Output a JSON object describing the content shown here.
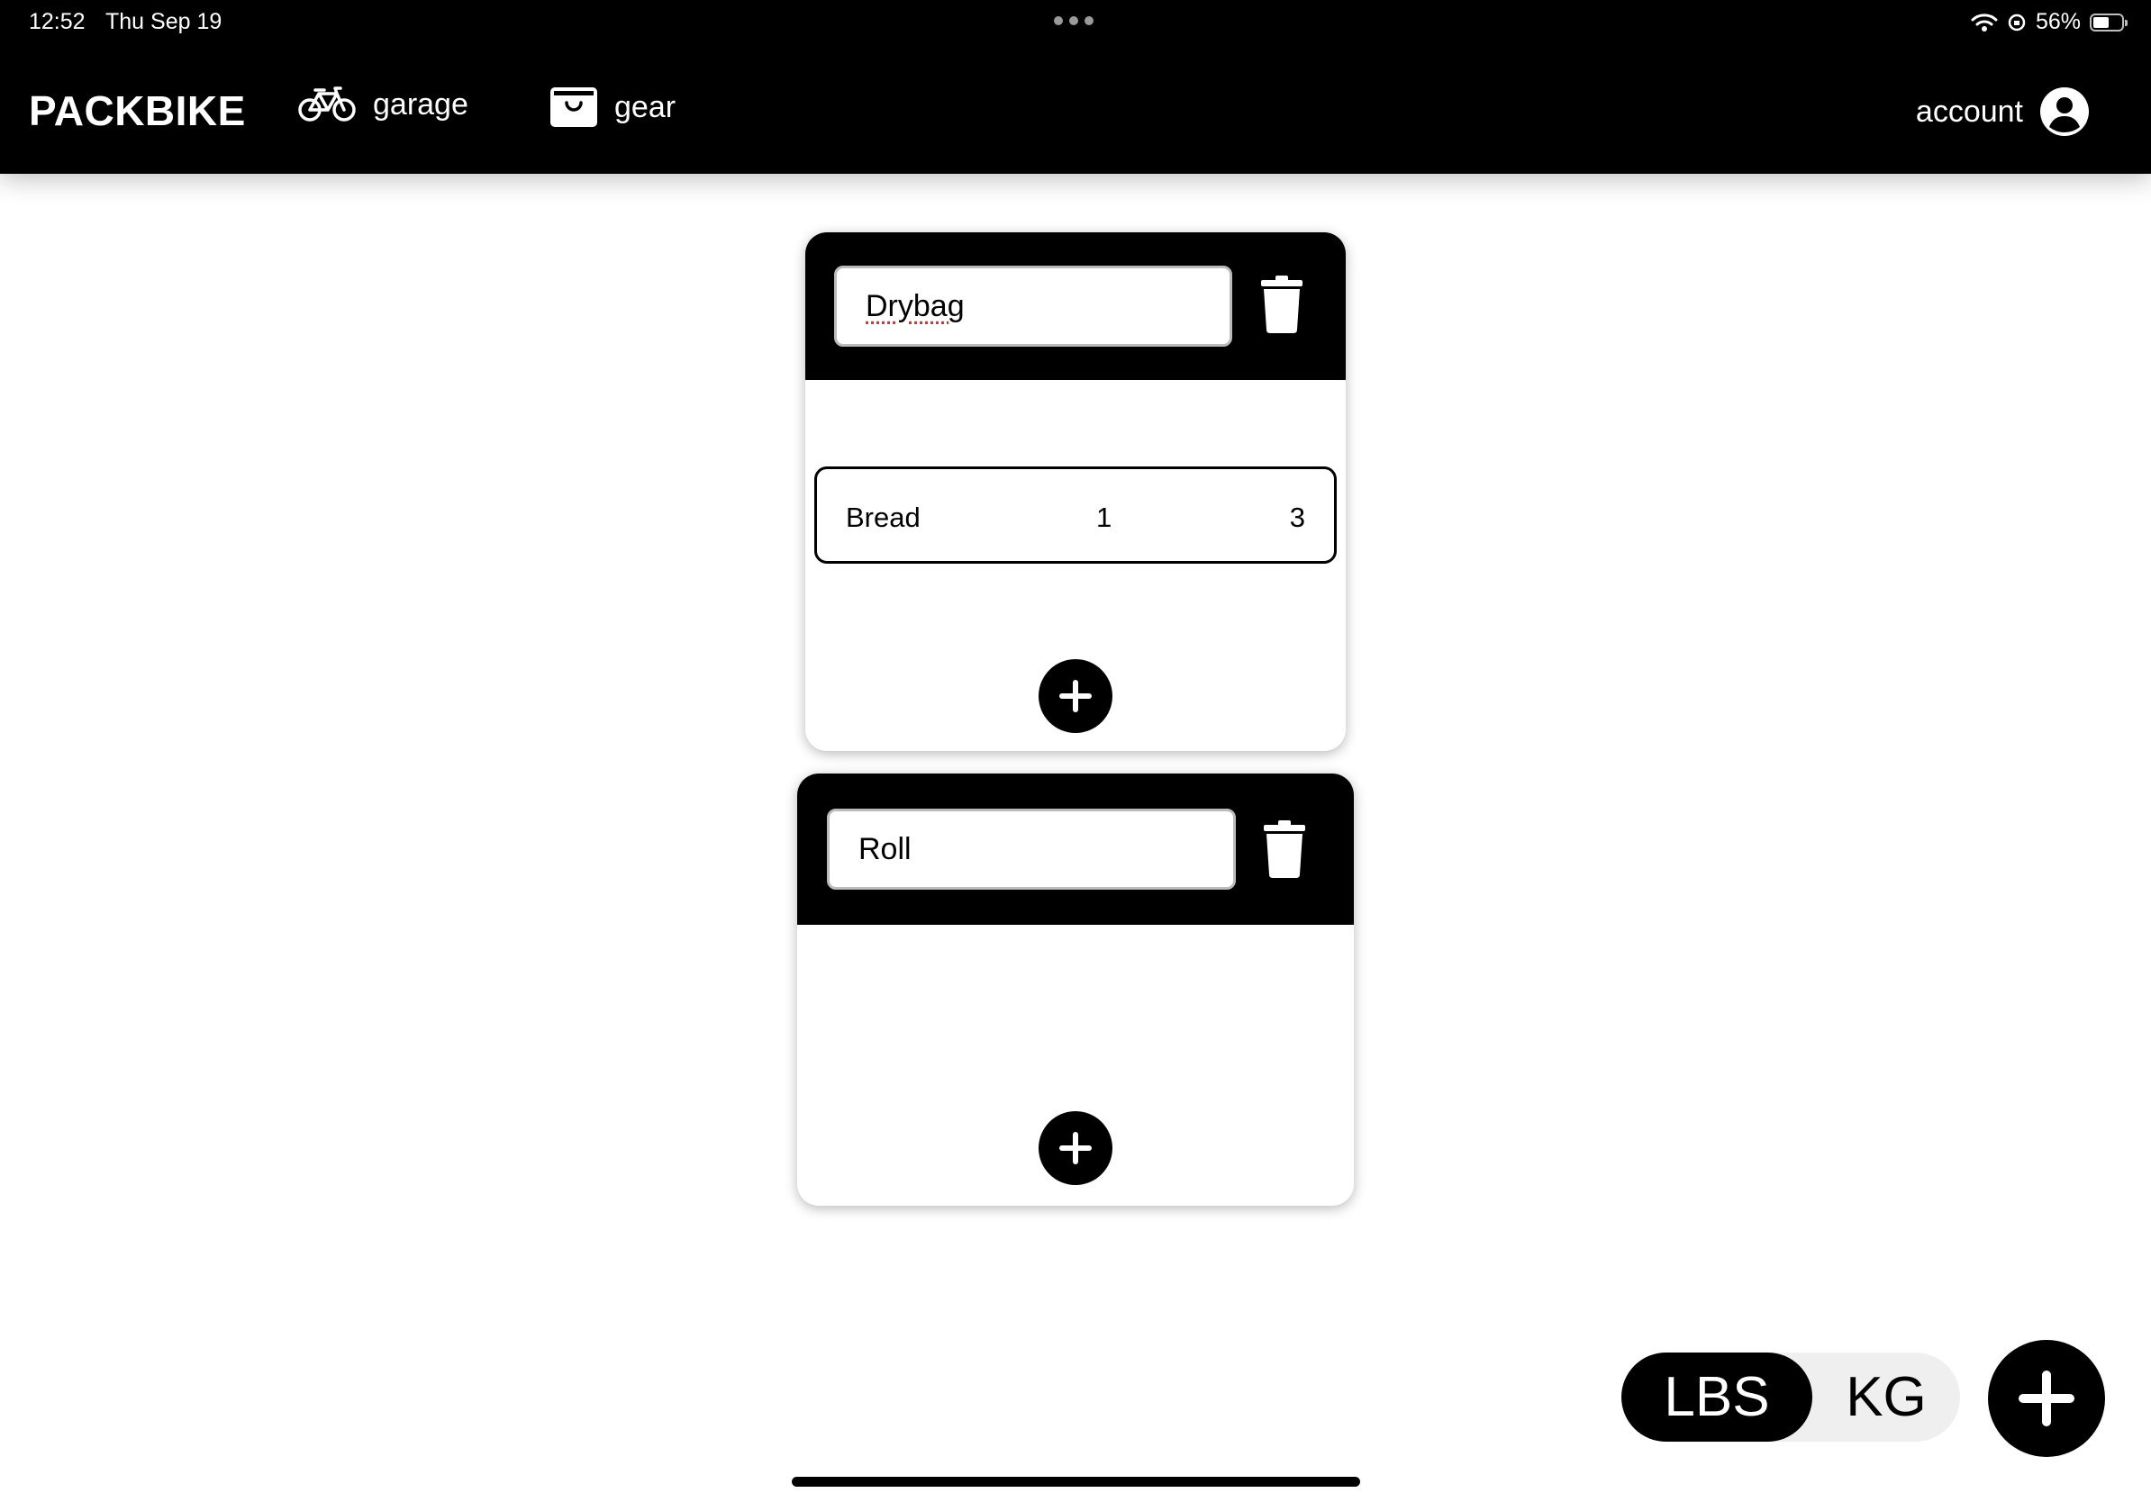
{
  "status_bar": {
    "time": "12:52",
    "date": "Thu Sep 19",
    "battery": "56%",
    "battery_level": 0.56
  },
  "nav": {
    "brand": "PACKBIKE",
    "garage": {
      "label": "garage",
      "icon": "bicycle-icon"
    },
    "gear": {
      "label": "gear",
      "icon": "shopping-bag-icon"
    },
    "account": {
      "label": "account",
      "icon": "user-circle-icon"
    }
  },
  "packs": [
    {
      "name": "Drybag",
      "items": [
        {
          "name": "Bread",
          "quantity": "1",
          "weight": "3"
        }
      ]
    },
    {
      "name": "Roll",
      "items": []
    }
  ],
  "units": {
    "options": [
      "LBS",
      "KG"
    ],
    "selected": "LBS"
  },
  "colors": {
    "primary": "#000000",
    "background": "#ffffff",
    "toggle_bg": "#efefef"
  }
}
